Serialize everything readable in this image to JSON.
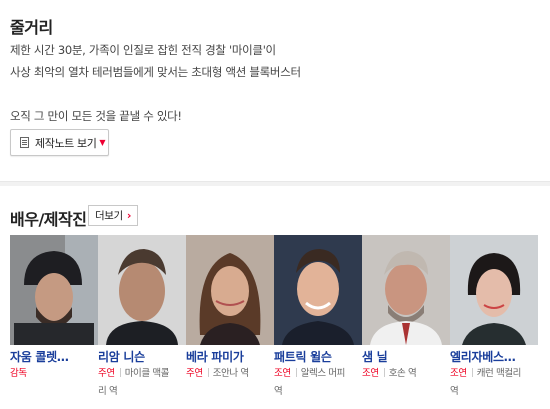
{
  "story": {
    "title": "줄거리",
    "lines": [
      "제한 시간 30분, 가족이 인질로 잡힌 전직 경찰 '마이클'이",
      " 사상 최악의 열차 테러범들에게 맞서는 초대형 액션 블록버스터",
      "",
      "오직 그 만이 모든 것을 끝낼 수 있다!"
    ],
    "note_button_label": "제작노트 보기"
  },
  "cast": {
    "title": "배우/제작진",
    "more_label": "더보기",
    "people": [
      {
        "name": "자움 콜렛…",
        "role": "감독",
        "character_1": "",
        "character_2": ""
      },
      {
        "name": "리암 니슨",
        "role": "주연",
        "character_1": "마이클 맥콜",
        "character_2": "리 역"
      },
      {
        "name": "베라 파미가",
        "role": "주연",
        "character_1": "조안나 역",
        "character_2": ""
      },
      {
        "name": "패트릭 윌슨",
        "role": "조연",
        "character_1": "알렉스 머피",
        "character_2": "역"
      },
      {
        "name": "샘 닐",
        "role": "조연",
        "character_1": "호손 역",
        "character_2": ""
      },
      {
        "name": "엘리자베스…",
        "role": "조연",
        "character_1": "캐런 맥컬리",
        "character_2": "역"
      }
    ]
  },
  "colors": {
    "name_link": "#1a3e9b",
    "role_accent": "#e02020"
  }
}
